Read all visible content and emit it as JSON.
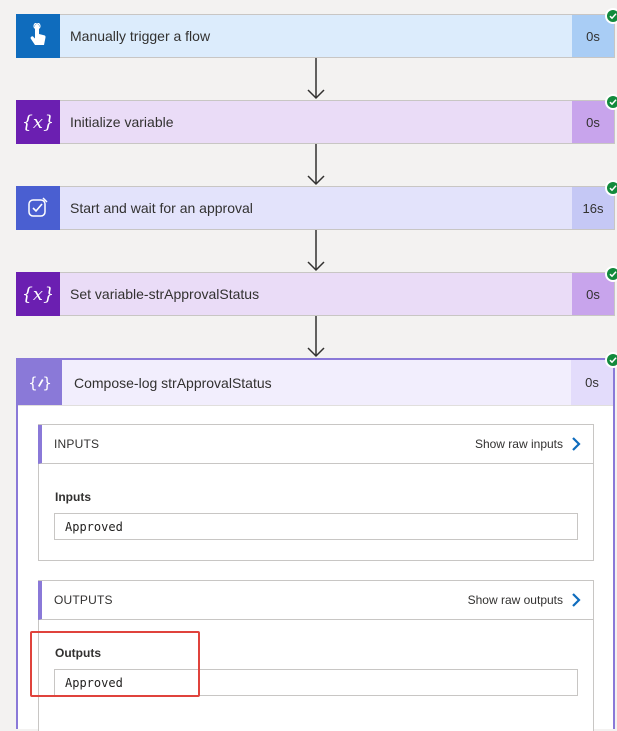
{
  "steps": [
    {
      "title": "Manually trigger a flow",
      "duration": "0s",
      "icon": "hand-touch-icon",
      "bg": "#dcecfc",
      "icon_bg": "#0f6cbd",
      "dur_bg": "#a9cdf5"
    },
    {
      "title": "Initialize variable",
      "duration": "0s",
      "icon": "variable-icon",
      "bg": "#eadcf7",
      "icon_bg": "#6b1fb1",
      "dur_bg": "#c8a4ec"
    },
    {
      "title": "Start and wait for an approval",
      "duration": "16s",
      "icon": "approval-icon",
      "bg": "#e3e3fb",
      "icon_bg": "#4a5fd1",
      "dur_bg": "#c5c8f5"
    },
    {
      "title": "Set variable-strApprovalStatus",
      "duration": "0s",
      "icon": "variable-icon",
      "bg": "#eadcf7",
      "icon_bg": "#6b1fb1",
      "dur_bg": "#c8a4ec"
    }
  ],
  "compose": {
    "title": "Compose-log strApprovalStatus",
    "duration": "0s",
    "icon": "compose-icon",
    "inputs": {
      "header": "INPUTS",
      "raw_link": "Show raw inputs",
      "label": "Inputs",
      "value": "Approved"
    },
    "outputs": {
      "header": "OUTPUTS",
      "raw_link": "Show raw outputs",
      "label": "Outputs",
      "value": "Approved"
    }
  },
  "colors": {
    "success": "#128a3c",
    "highlight": "#e0433c",
    "compose_accent": "#8a79d8"
  }
}
